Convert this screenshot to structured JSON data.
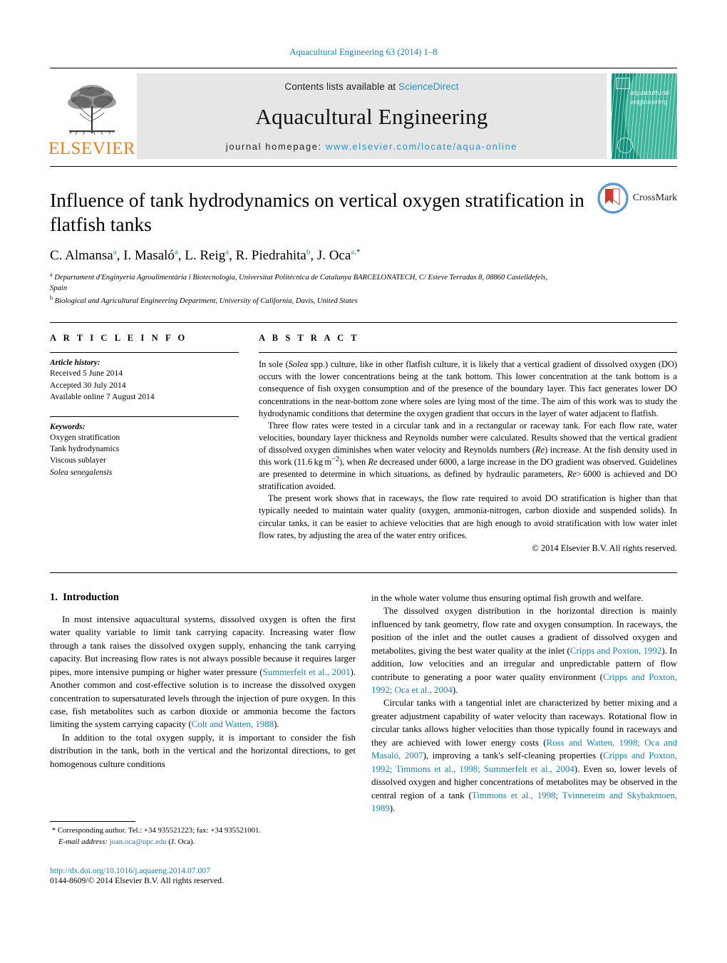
{
  "running_head": "Aquacultural Engineering 63 (2014) 1–8",
  "masthead": {
    "contents_prefix": "Contents lists available at",
    "sciencedirect": "ScienceDirect",
    "journal_title": "Aquacultural Engineering",
    "homepage_prefix": "journal homepage:",
    "homepage_url": "www.elsevier.com/locate/aqua-online",
    "publisher_wordmark": "ELSEVIER",
    "cover_title_line1": "aquacultural",
    "cover_title_line2": "engineering",
    "link_color": "#2196c4",
    "elsevier_orange": "#F07F1A",
    "cover_teal": "#12907c"
  },
  "article": {
    "title": "Influence of tank hydrodynamics on vertical oxygen stratification in flatfish tanks",
    "authors": "C. Almansa, I. Masaló, L. Reig, R. Piedrahita, J. Oca",
    "authors_html": "C. Almansa<sup>a</sup>, I. Masaló<sup>a</sup>, L. Reig<sup>a</sup>, R. Piedrahita<sup>b</sup>, J. Oca<sup>a,*</sup>",
    "affiliation_a": "Departament d'Enginyeria Agroalimentària i Biotecnologia, Universitat Politècnica de Catalunya BARCELONATECH, C/ Esteve Terradas 8, 08860 Castelldefels, Spain",
    "affiliation_b": "Biological and Agricultural Engineering Department, University of California, Davis, United States",
    "crossmark_label": "CrossMark"
  },
  "article_info": {
    "heading": "A R T I C L E    I N F O",
    "history_label": "Article history:",
    "history": [
      "Received 5 June 2014",
      "Accepted 30 July 2014",
      "Available online 7 August 2014"
    ],
    "keywords_label": "Keywords:",
    "keywords": [
      "Oxygen stratification",
      "Tank hydrodynamics",
      "Viscous sublayer",
      "Solea senegalensis"
    ]
  },
  "abstract": {
    "heading": "A B S T R A C T",
    "paragraph1": "In sole (Solea spp.) culture, like in other flatfish culture, it is likely that a vertical gradient of dissolved oxygen (DO) occurs with the lower concentrations being at the tank bottom. This lower concentration at the tank bottom is a consequence of fish oxygen consumption and of the presence of the boundary layer. This fact generates lower DO concentrations in the near-bottom zone where soles are lying most of the time. The aim of this work was to study the hydrodynamic conditions that determine the oxygen gradient that occurs in the layer of water adjacent to flatfish.",
    "paragraph2": "Three flow rates were tested in a circular tank and in a rectangular or raceway tank. For each flow rate, water velocities, boundary layer thickness and Reynolds number were calculated. Results showed that the vertical gradient of dissolved oxygen diminishes when water velocity and Reynolds numbers (Re) increase. At the fish density used in this work (11.6 kg m−2), when Re decreased under 6000, a large increase in the DO gradient was observed. Guidelines are presented to determine in which situations, as defined by hydraulic parameters, Re > 6000 is achieved and DO stratification avoided.",
    "paragraph3": "The present work shows that in raceways, the flow rate required to avoid DO stratification is higher than that typically needed to maintain water quality (oxygen, ammonia-nitrogen, carbon dioxide and suspended solids). In circular tanks, it can be easier to achieve velocities that are high enough to avoid stratification with low water inlet flow rates, by adjusting the area of the water entry orifices.",
    "copyright": "© 2014 Elsevier B.V. All rights reserved."
  },
  "introduction": {
    "section_number": "1.",
    "section_title": "Introduction",
    "left_p1_a": "In most intensive aquacultural systems, dissolved oxygen is often the first water quality variable to limit tank carrying capacity. Increasing water flow through a tank raises the dissolved oxygen supply, enhancing the tank carrying capacity. But increasing flow rates is not always possible because it requires larger pipes, more intensive pumping or higher water pressure (",
    "left_p1_cite1": "Summerfelt et al., 2001",
    "left_p1_b": "). Another common and cost-effective solution is to increase the dissolved oxygen concentration to supersaturated levels through the injection of pure oxygen. In this case, fish metabolites such as carbon dioxide or ammonia become the factors limiting the system carrying capacity (",
    "left_p1_cite2": "Colt and Watten, 1988",
    "left_p1_c": ").",
    "left_p2": "In addition to the total oxygen supply, it is important to consider the fish distribution in the tank, both in the vertical and the horizontal directions, to get homogenous culture conditions",
    "right_p0": "in the whole water volume thus ensuring optimal fish growth and welfare.",
    "right_p1_a": "The dissolved oxygen distribution in the horizontal direction is mainly influenced by tank geometry, flow rate and oxygen consumption. In raceways, the position of the inlet and the outlet causes a gradient of dissolved oxygen and metabolites, giving the best water quality at the inlet (",
    "right_p1_cite1": "Cripps and Poxton, 1992",
    "right_p1_b": "). In addition, low velocities and an irregular and unpredictable pattern of flow contribute to generating a poor water quality environment (",
    "right_p1_cite2": "Cripps and Poxton, 1992; Oca et al., 2004",
    "right_p1_c": ").",
    "right_p2_a": "Circular tanks with a tangential inlet are characterized by better mixing and a greater adjustment capability of water velocity than raceways. Rotational flow in circular tanks allows higher velocities than those typically found in raceways and they are achieved with lower energy costs (",
    "right_p2_cite1": "Ross and Watten, 1998; Oca and Masaló, 2007",
    "right_p2_b": "), improving a tank's self-cleaning properties (",
    "right_p2_cite2": "Cripps and Poxton, 1992; Timmons et al., 1998; Summerfelt et al., 2004",
    "right_p2_c": "). Even so, lower levels of dissolved oxygen and higher concentrations of metabolites may be observed in the central region of a tank (",
    "right_p2_cite3": "Timmons et al., 1998; Tvinnereim and Skybakmoen, 1989",
    "right_p2_d": ")."
  },
  "footer": {
    "corresponding_marker": "*",
    "corresponding_text": "Corresponding author. Tel.: +34 935521223; fax: +34 935521001.",
    "email_label": "E-mail address:",
    "email": "joan.oca@upc.edu",
    "email_suffix": "(J. Oca).",
    "doi_url": "http://dx.doi.org/10.1016/j.aquaeng.2014.07.007",
    "issn_line": "0144-8609/© 2014 Elsevier B.V. All rights reserved."
  }
}
